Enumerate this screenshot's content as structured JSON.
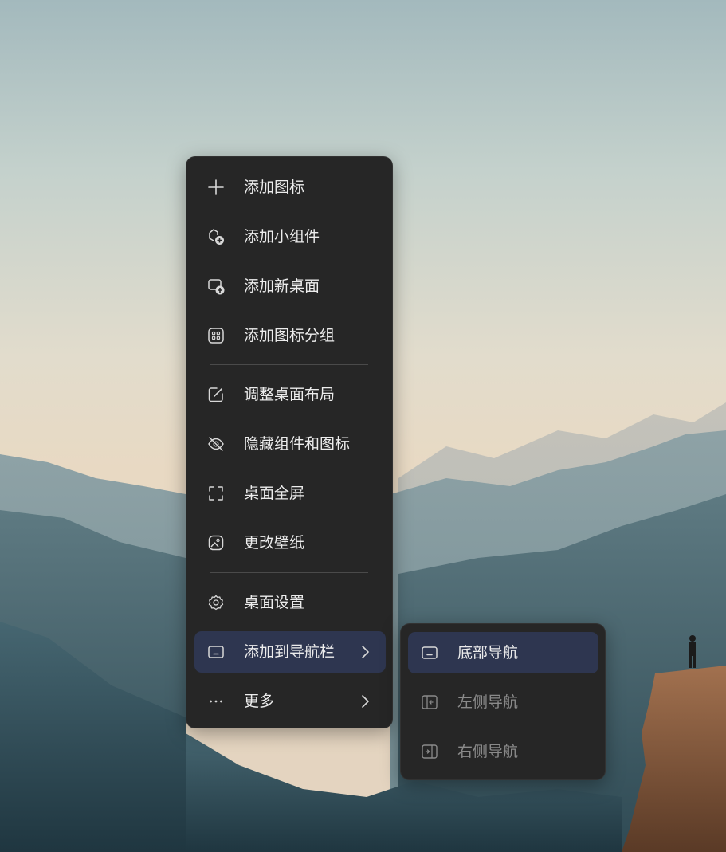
{
  "colors": {
    "menu_bg": "#262626",
    "highlight": "#2e3650",
    "text": "#ececec",
    "text_disabled": "#8a8a8a",
    "separator": "#4a4a4a"
  },
  "context_menu": {
    "items": [
      {
        "label": "添加图标",
        "icon": "plus-icon"
      },
      {
        "label": "添加小组件",
        "icon": "add-widget-icon"
      },
      {
        "label": "添加新桌面",
        "icon": "add-desktop-icon"
      },
      {
        "label": "添加图标分组",
        "icon": "icon-group-icon"
      },
      {
        "label": "调整桌面布局",
        "icon": "edit-layout-icon"
      },
      {
        "label": "隐藏组件和图标",
        "icon": "eye-off-icon"
      },
      {
        "label": "桌面全屏",
        "icon": "fullscreen-icon"
      },
      {
        "label": "更改壁纸",
        "icon": "wallpaper-icon"
      },
      {
        "label": "桌面设置",
        "icon": "gear-icon"
      },
      {
        "label": "添加到导航栏",
        "icon": "navbar-icon",
        "has_submenu": true,
        "active": true
      },
      {
        "label": "更多",
        "icon": "more-dots-icon",
        "has_submenu": true
      }
    ]
  },
  "submenu": {
    "items": [
      {
        "label": "底部导航",
        "icon": "bottom-nav-icon",
        "active": true,
        "enabled": true
      },
      {
        "label": "左侧导航",
        "icon": "left-nav-icon",
        "enabled": false
      },
      {
        "label": "右侧导航",
        "icon": "right-nav-icon",
        "enabled": false
      }
    ]
  }
}
